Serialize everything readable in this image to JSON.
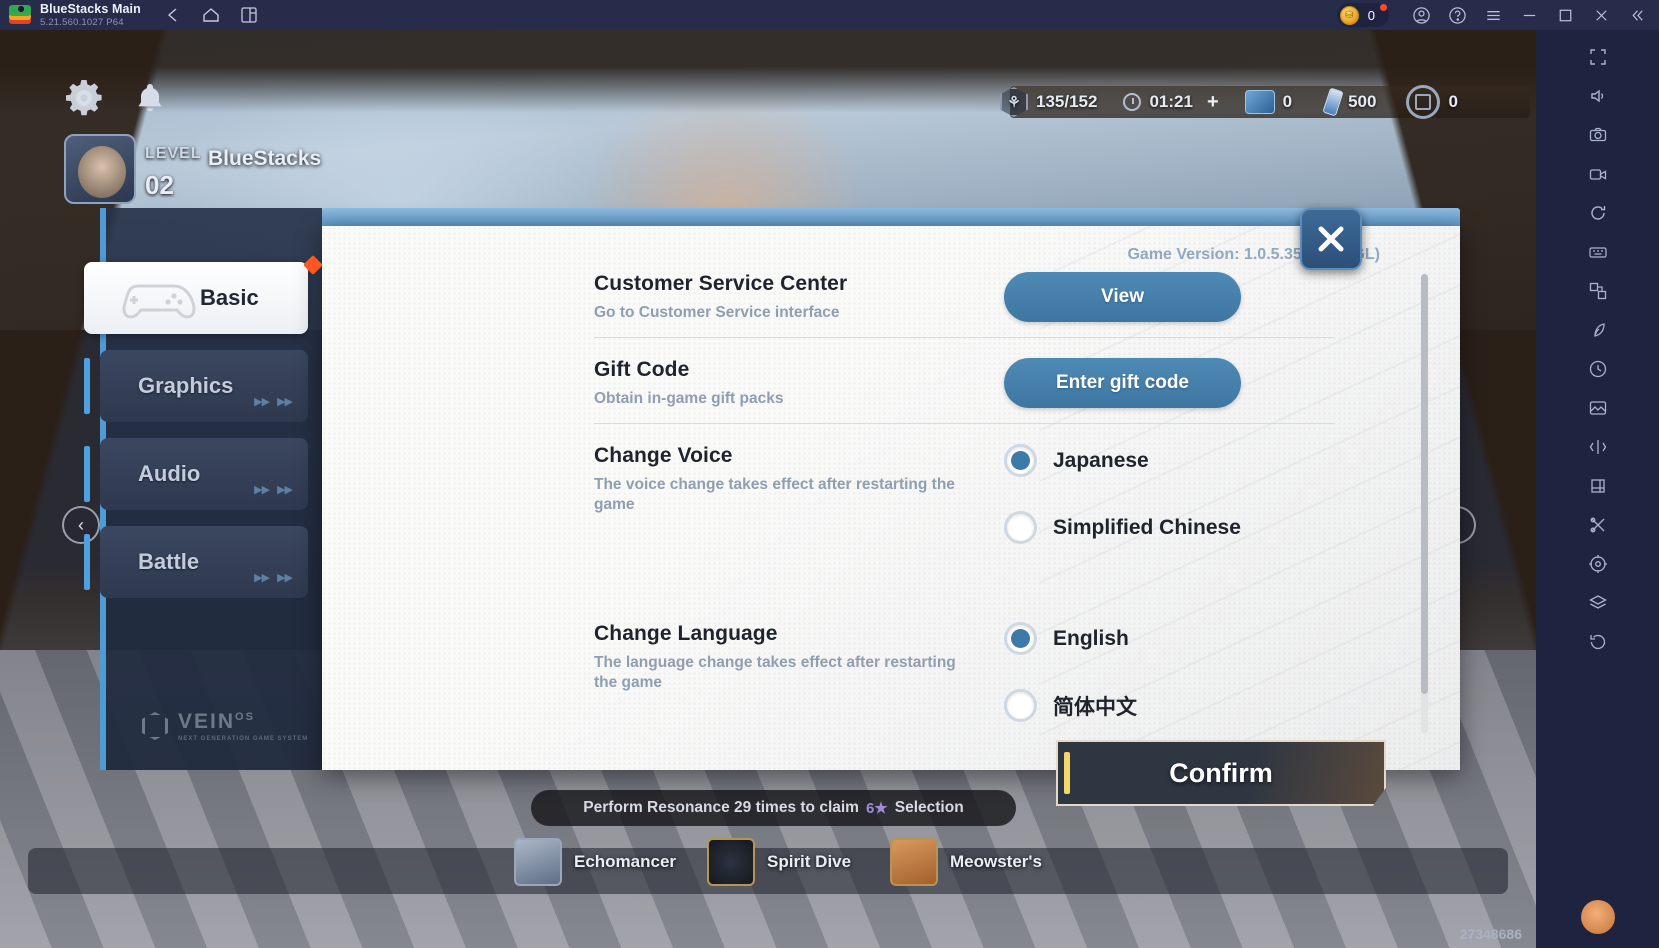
{
  "titlebar": {
    "app_title": "BlueStacks Main",
    "app_version": "5.21.560.1027  P64",
    "icons": [
      "back-arrow-icon",
      "home-icon",
      "multi-instance-icon"
    ],
    "coin_count": "0",
    "window_buttons": [
      "profile-icon",
      "help-icon",
      "menu-icon",
      "minimize-icon",
      "maximize-icon",
      "close-icon",
      "collapse-icon"
    ]
  },
  "game_hud": {
    "stamina": "135/152",
    "timer": "01:21",
    "gem_count": "0",
    "vial_count": "500",
    "ring_count": "0",
    "level_label": "LEVEL",
    "level_value": "02",
    "player_name": "BlueStacks"
  },
  "modal": {
    "game_version": "Game Version: 1.0.5.35 (OpenGL)",
    "close_label": "close-dialog",
    "brand": {
      "name": "VEIN",
      "superscript": "OS",
      "tagline": "NEXT GENERATION GAME SYSTEM"
    },
    "tabs": [
      {
        "label": "Basic",
        "active": true,
        "has_badge": true,
        "icon": "gamepad-icon"
      },
      {
        "label": "Graphics",
        "active": false,
        "has_badge": false,
        "icon": "display-icon"
      },
      {
        "label": "Audio",
        "active": false,
        "has_badge": false,
        "icon": "speaker-icon"
      },
      {
        "label": "Battle",
        "active": false,
        "has_badge": false,
        "icon": "sword-icon"
      }
    ],
    "settings": [
      {
        "title": "Customer Service Center",
        "desc": "Go to Customer Service interface",
        "control": "button",
        "button_label": "View"
      },
      {
        "title": "Gift Code",
        "desc": "Obtain in-game gift packs",
        "control": "button",
        "button_label": "Enter gift code"
      },
      {
        "title": "Change Voice",
        "desc": "The voice change takes effect after restarting the game",
        "control": "radio",
        "options": [
          {
            "label": "Japanese",
            "selected": true
          },
          {
            "label": "Simplified Chinese",
            "selected": false
          }
        ]
      },
      {
        "title": "Change Language",
        "desc": "The language change takes effect after restarting the game",
        "control": "radio",
        "options": [
          {
            "label": "English",
            "selected": true
          },
          {
            "label": "简体中文",
            "selected": false
          }
        ]
      }
    ],
    "confirm_label": "Confirm"
  },
  "game_overlay": {
    "toast_text_before": "Perform Resonance 29 times to claim",
    "toast_star": "6★",
    "toast_text_after": "Selection",
    "bottom_nav": [
      {
        "label": "Echomancer",
        "icon": "person-icon"
      },
      {
        "label": "Spirit Dive",
        "icon": "portal-icon"
      },
      {
        "label": "Meowster's",
        "icon": "cat-icon"
      }
    ],
    "build_number": "27348686"
  },
  "right_sidebar": {
    "items": [
      "fullscreen-icon",
      "volume-icon",
      "screenshot-icon",
      "video-record-icon",
      "rotate-icon",
      "keymap-icon",
      "multi-instance-sync-icon",
      "eco-mode-icon",
      "macro-icon",
      "gallery-icon",
      "shake-icon",
      "location-icon",
      "trim-icon",
      "pin-icon",
      "layers-icon",
      "refresh-icon"
    ],
    "cat_assistant": "cat-assistant-icon"
  },
  "colors": {
    "accent_blue": "#3d7aa8",
    "rail_accent": "#4f9bd6",
    "badge_red": "#ff5722",
    "confirm_gold": "#f5d66a"
  }
}
